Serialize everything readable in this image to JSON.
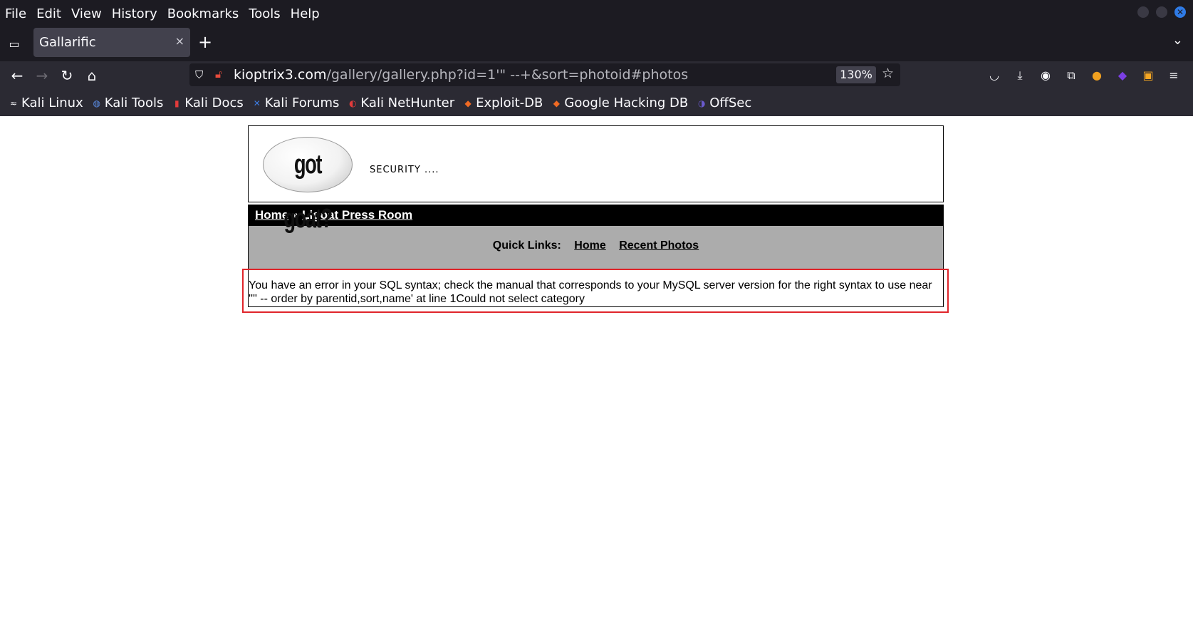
{
  "menubar": {
    "items": [
      "File",
      "Edit",
      "View",
      "History",
      "Bookmarks",
      "Tools",
      "Help"
    ]
  },
  "tab": {
    "title": "Gallarific",
    "close_label": "×"
  },
  "newtab_label": "+",
  "navbar": {
    "url_domain": "kioptrix3.com",
    "url_path": "/gallery/gallery.php?id=1'\" --+&sort=photoid#photos",
    "zoom": "130%"
  },
  "bookmarks": [
    {
      "label": "Kali Linux"
    },
    {
      "label": "Kali Tools"
    },
    {
      "label": "Kali Docs"
    },
    {
      "label": "Kali Forums"
    },
    {
      "label": "Kali NetHunter"
    },
    {
      "label": "Exploit-DB"
    },
    {
      "label": "Google Hacking DB"
    },
    {
      "label": "OffSec"
    }
  ],
  "page": {
    "logo_text": "got goat?",
    "tagline": "SECURITY ....",
    "breadcrumb": {
      "home": "Home",
      "sep": " » ",
      "current": "Ligoat Press Room"
    },
    "quicklinks": {
      "label": "Quick Links:",
      "home": "Home",
      "recent": "Recent Photos"
    },
    "error": "You have an error in your SQL syntax; check the manual that corresponds to your MySQL server version for the right syntax to use near ''\" -- order by parentid,sort,name' at line 1Could not select category"
  },
  "colors": {
    "highlight": "#e0252b",
    "chrome_bg": "#1c1b22",
    "quicklinks_bg": "#acacac"
  }
}
